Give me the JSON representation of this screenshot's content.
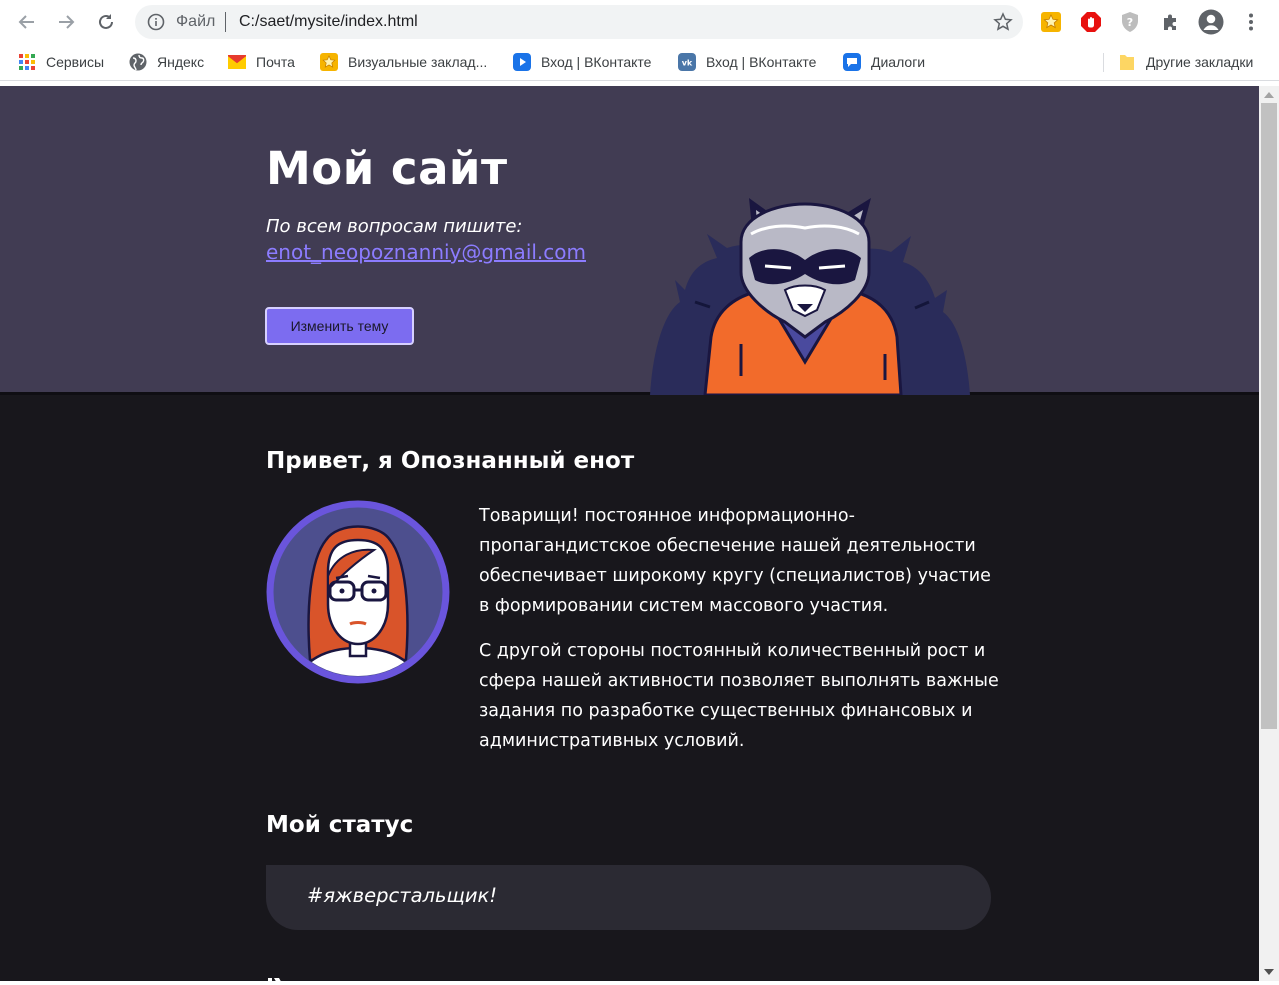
{
  "browser": {
    "scheme_label": "Файл",
    "url": "C:/saet/mysite/index.html",
    "bookmarks": [
      {
        "label": "Сервисы",
        "icon": "apps-grid-icon"
      },
      {
        "label": "Яндекс",
        "icon": "globe-icon"
      },
      {
        "label": "Почта",
        "icon": "mail-icon"
      },
      {
        "label": "Визуальные заклад...",
        "icon": "visual-bookmarks-icon"
      },
      {
        "label": "Вход | ВКонтакте",
        "icon": "vk-play-icon"
      },
      {
        "label": "Вход | ВКонтакте",
        "icon": "vk-icon"
      },
      {
        "label": "Диалоги",
        "icon": "chat-icon"
      },
      {
        "label": "Другие закладки",
        "icon": "folder-icon"
      }
    ]
  },
  "hero": {
    "title": "Мой сайт",
    "contact_text": "По всем вопросам пишите:",
    "email": "enot_neopoznanniy@gmail.com",
    "theme_button": "Изменить тему"
  },
  "about": {
    "heading": "Привет, я Опознанный енот",
    "paragraphs": [
      "Товарищи! постоянное информационно-пропагандистское обеспечение нашей деятельности обеспечивает широкому кругу (специалистов) участие в формировании систем массового участия.",
      "С другой стороны постоянный количественный рост и сфера нашей активности позволяет выполнять важные задания по разработке существенных финансовых и административных условий."
    ]
  },
  "status": {
    "heading": "Мой статус",
    "text": "#яжверстальщик!"
  },
  "colors": {
    "hero_bg": "#413c53",
    "page_bg": "#18171c",
    "accent": "#7c6cf0",
    "link": "#8c7cff",
    "status_bg": "#2b2a33"
  }
}
